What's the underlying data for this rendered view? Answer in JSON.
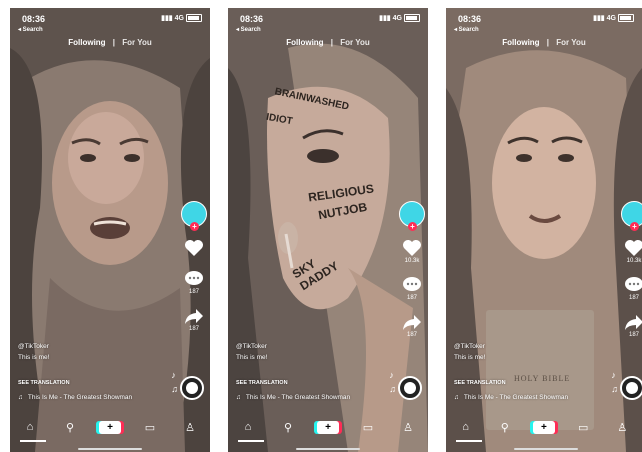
{
  "screens": [
    {
      "status": {
        "time": "08:36",
        "network": "4G"
      },
      "back_label": "◂ Search",
      "tabs": {
        "following": "Following",
        "separator": "|",
        "for_you": "For You"
      },
      "likes": "",
      "comments": "187",
      "shares": "187",
      "caption": {
        "user": "@TikToker",
        "text": "This is me!"
      },
      "see_translation": "SEE TRANSLATION",
      "sound": "This Is Me - The Greatest Showman",
      "overlay_text": []
    },
    {
      "status": {
        "time": "08:36",
        "network": "4G"
      },
      "back_label": "◂ Search",
      "tabs": {
        "following": "Following",
        "separator": "|",
        "for_you": "For You"
      },
      "likes": "10.3k",
      "comments": "187",
      "shares": "187",
      "caption": {
        "user": "@TikToker",
        "text": "This is me!"
      },
      "see_translation": "SEE TRANSLATION",
      "sound": "This Is Me - The Greatest Showman",
      "overlay_text": [
        "BRAINWASHED",
        "IDIOT",
        "RELIGIOUS",
        "NUTJOB",
        "SKY DADDY"
      ]
    },
    {
      "status": {
        "time": "08:36",
        "network": "4G"
      },
      "back_label": "◂ Search",
      "tabs": {
        "following": "Following",
        "separator": "|",
        "for_you": "For You"
      },
      "likes": "10.3k",
      "comments": "187",
      "shares": "187",
      "caption": {
        "user": "@TikToker",
        "text": "This is me!"
      },
      "see_translation": "SEE TRANSLATION",
      "sound": "This Is Me - The Greatest Showman",
      "overlay_text": [
        "HOLY BIBLE"
      ]
    }
  ],
  "colors": {
    "avatar": "#3fd6e6",
    "follow_plus": "#ff2d55",
    "create_left": "#25f4ee",
    "create_right": "#fe2c55"
  },
  "icons": {
    "nav": [
      "home-icon",
      "search-icon",
      "create-icon",
      "inbox-icon",
      "profile-icon"
    ]
  }
}
